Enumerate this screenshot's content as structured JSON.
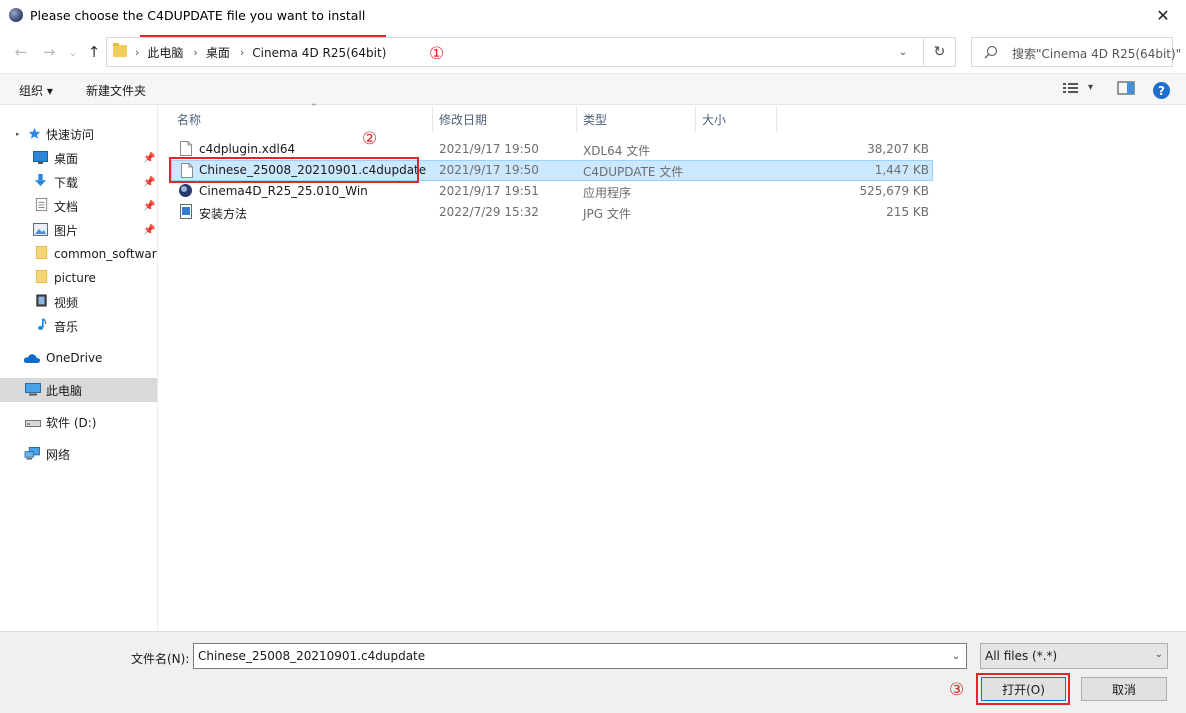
{
  "window": {
    "title": "Please choose the C4DUPDATE file you want to install",
    "close_glyph": "✕"
  },
  "nav": {
    "back_glyph": "←",
    "forward_glyph": "→",
    "recent_glyph": "⌄",
    "up_glyph": "↑",
    "breadcrumbs": [
      "此电脑",
      "桌面",
      "Cinema 4D R25(64bit)"
    ],
    "refresh_glyph": "↻",
    "search_placeholder": "搜索\"Cinema 4D R25(64bit)\""
  },
  "annotations": {
    "step1": "①",
    "step2": "②",
    "step3": "③",
    "color": "#e0262b"
  },
  "toolbar": {
    "organize": "组织 ▾",
    "new_folder": "新建文件夹"
  },
  "sidebar": {
    "quick_access": "快速访问",
    "items": [
      {
        "label": "桌面",
        "icon": "desktop-icon",
        "pinned": true
      },
      {
        "label": "下载",
        "icon": "download-icon",
        "pinned": true
      },
      {
        "label": "文档",
        "icon": "document-icon",
        "pinned": true
      },
      {
        "label": "图片",
        "icon": "picture-icon",
        "pinned": true
      },
      {
        "label": "common_software",
        "icon": "folder-icon",
        "pinned": false
      },
      {
        "label": "picture",
        "icon": "folder-icon",
        "pinned": false
      },
      {
        "label": "视频",
        "icon": "video-icon",
        "pinned": false
      },
      {
        "label": "音乐",
        "icon": "music-icon",
        "pinned": false
      }
    ],
    "onedrive": "OneDrive",
    "this_pc": "此电脑",
    "drive": "软件 (D:)",
    "network": "网络"
  },
  "columns": {
    "name": "名称",
    "date": "修改日期",
    "type": "类型",
    "size": "大小"
  },
  "files": [
    {
      "name": "c4dplugin.xdl64",
      "date": "2021/9/17 19:50",
      "type": "XDL64 文件",
      "size": "38,207 KB"
    },
    {
      "name": "Chinese_25008_20210901.c4dupdate",
      "date": "2021/9/17 19:50",
      "type": "C4DUPDATE 文件",
      "size": "1,447 KB"
    },
    {
      "name": "Cinema4D_R25_25.010_Win",
      "date": "2021/9/17 19:51",
      "type": "应用程序",
      "size": "525,679 KB"
    },
    {
      "name": "安装方法",
      "date": "2022/7/29 15:32",
      "type": "JPG 文件",
      "size": "215 KB"
    }
  ],
  "bottom": {
    "filename_label": "文件名(N):",
    "filename_value": "Chinese_25008_20210901.c4dupdate",
    "filter": "All files (*.*)",
    "open": "打开(O)",
    "cancel": "取消"
  }
}
